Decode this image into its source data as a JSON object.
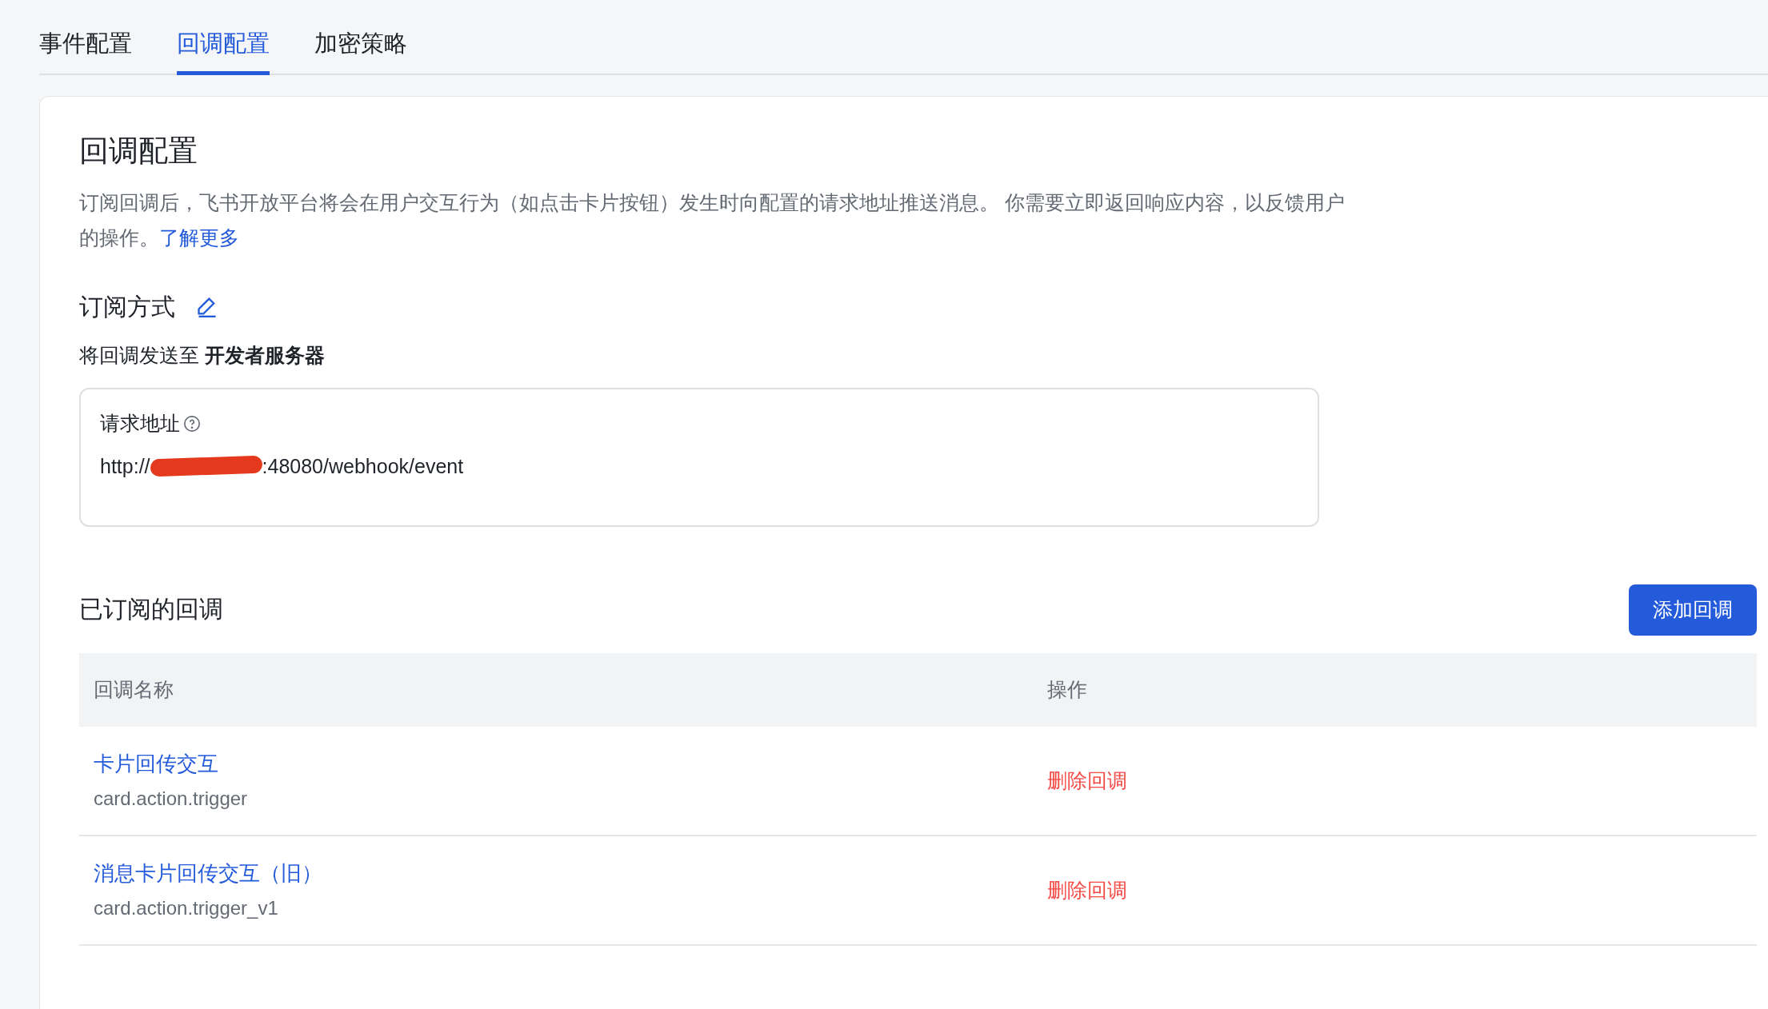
{
  "tabs": [
    {
      "label": "事件配置",
      "selected": false
    },
    {
      "label": "回调配置",
      "selected": true
    },
    {
      "label": "加密策略",
      "selected": false
    }
  ],
  "section": {
    "title": "回调配置",
    "description": "订阅回调后，飞书开放平台将会在用户交互行为（如点击卡片按钮）发生时向配置的请求地址推送消息。 你需要立即返回响应内容，以反馈用户的操作。",
    "learn_more": "了解更多"
  },
  "subscription": {
    "title": "订阅方式",
    "target": "将回调发送至 **开发者服务器**",
    "url_label": "请求地址",
    "url_start": "http://",
    "url_end": ":48080/webhook/event"
  },
  "callbacks": {
    "title": "已订阅的回调",
    "add_button": "添加回调",
    "columns": [
      "回调名称",
      "操作"
    ],
    "rows": [
      {
        "name": "卡片回传交互",
        "id": "card.action.trigger",
        "action": "删除回调"
      },
      {
        "name": "消息卡片回传交互（旧）",
        "id": "card.action.trigger_v1",
        "action": "删除回调"
      }
    ]
  }
}
